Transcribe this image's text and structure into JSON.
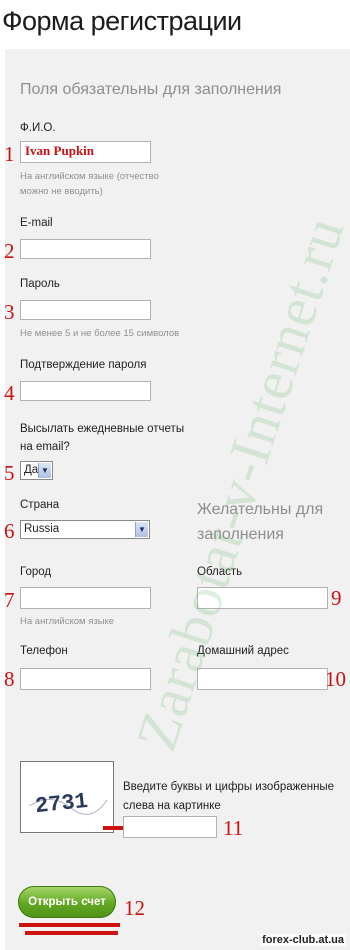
{
  "page_title": "Форма регистрации",
  "required_heading": "Поля обязательны для заполнения",
  "optional_heading": "Желательны для заполнения",
  "fields": {
    "fio": {
      "label": "Ф.И.О.",
      "value": "Ivan Pupkin",
      "hint": "На английском языке (отчество можно не вводить)",
      "number": "1"
    },
    "email": {
      "label": "E-mail",
      "value": "",
      "number": "2"
    },
    "password": {
      "label": "Пароль",
      "value": "",
      "hint": "Не менее 5 и не более 15 символов",
      "number": "3"
    },
    "password_confirm": {
      "label": "Подтверждение пароля",
      "value": "",
      "number": "4"
    },
    "daily_reports": {
      "label": "Высылать ежедневные отчеты на email?",
      "value": "Да",
      "number": "5"
    },
    "country": {
      "label": "Страна",
      "value": "Russia",
      "number": "6"
    },
    "city": {
      "label": "Город",
      "value": "",
      "hint": "На английском языке",
      "number": "7"
    },
    "phone": {
      "label": "Телефон",
      "value": "",
      "number": "8"
    },
    "region": {
      "label": "Область",
      "value": "",
      "number": "9"
    },
    "home_address": {
      "label": "Домашний адрес",
      "value": "",
      "number": "10"
    },
    "captcha": {
      "label": "Введите буквы и цифры изображенные слева на картинке",
      "image_text": "2731",
      "value": "",
      "number": "11"
    }
  },
  "submit": {
    "label": "Открыть счет",
    "number": "12"
  },
  "watermark": "Zarabotat-v-Internet.ru",
  "site_tag": "forex-club.at.ua",
  "colors": {
    "accent_red": "#cc1111",
    "button_green": "#62a822",
    "panel_bg": "#f1f1f1"
  }
}
